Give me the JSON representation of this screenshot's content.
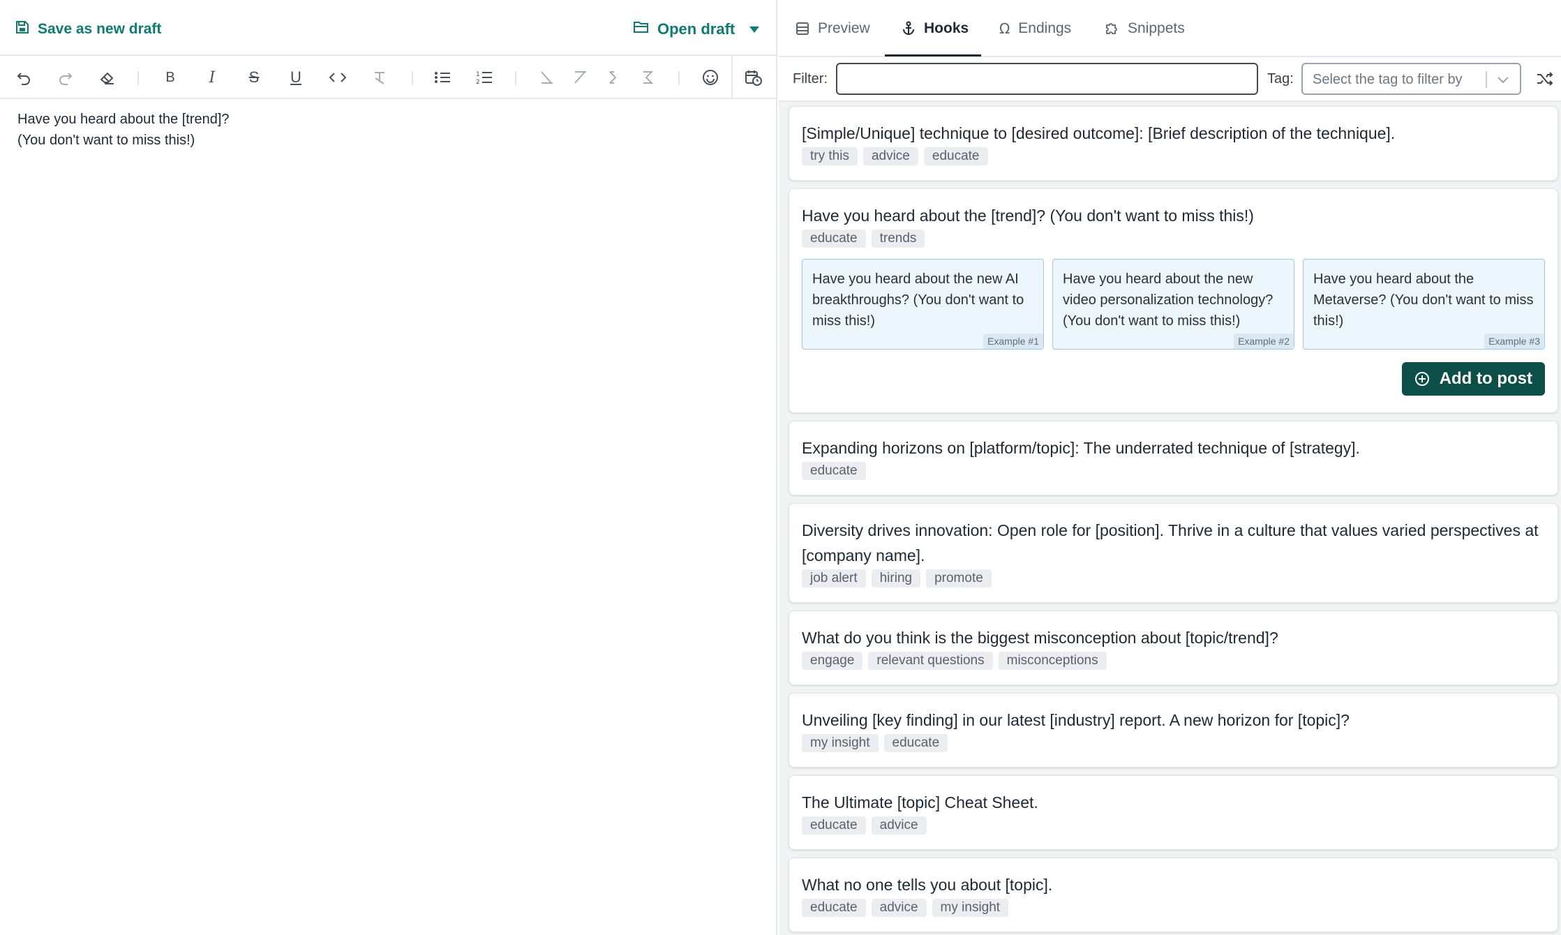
{
  "left_header": {
    "save_label": "Save as new draft",
    "open_label": "Open draft"
  },
  "toolbar": {
    "icons": [
      "undo-icon",
      "redo-icon",
      "eraser-icon",
      "bold-icon",
      "italic-icon",
      "strikethrough-icon",
      "underline-icon",
      "code-icon",
      "clear-format-icon",
      "bullet-list-icon",
      "numbered-list-icon",
      "format-1-icon",
      "format-2-icon",
      "format-3-icon",
      "format-4-icon",
      "emoji-icon",
      "schedule-icon"
    ],
    "bold": "B",
    "italic": "I",
    "strike": "S",
    "underline": "U"
  },
  "editor": {
    "lines": [
      "Have you heard about the [trend]?",
      "(You don't want to miss this!)"
    ]
  },
  "tabs": [
    {
      "label": "Preview",
      "icon": "preview-icon"
    },
    {
      "label": "Hooks",
      "icon": "anchor-icon",
      "active": true
    },
    {
      "label": "Endings",
      "icon": "omega-icon"
    },
    {
      "label": "Snippets",
      "icon": "puzzle-icon"
    }
  ],
  "filter": {
    "label": "Filter:",
    "value": "",
    "tag_label": "Tag:",
    "tag_placeholder": "Select the tag to filter by"
  },
  "hooks": [
    {
      "title": "[Simple/Unique] technique to [desired outcome]: [Brief description of the technique].",
      "tags": [
        "try this",
        "advice",
        "educate"
      ]
    },
    {
      "title": "Have you heard about the [trend]? (You don't want to miss this!)",
      "tags": [
        "educate",
        "trends"
      ],
      "examples": [
        {
          "text": "Have you heard about the new AI breakthroughs? (You don't want to miss this!)",
          "badge": "Example #1"
        },
        {
          "text": "Have you heard about the new video personalization technology? (You don't want to miss this!)",
          "badge": "Example #2"
        },
        {
          "text": "Have you heard about the Metaverse? (You don't want to miss this!)",
          "badge": "Example #3"
        }
      ],
      "action_label": "Add to post"
    },
    {
      "title": "Expanding horizons on [platform/topic]: The underrated technique of [strategy].",
      "tags": [
        "educate"
      ]
    },
    {
      "title": "Diversity drives innovation: Open role for [position]. Thrive in a culture that values varied perspectives at [company name].",
      "tags": [
        "job alert",
        "hiring",
        "promote"
      ]
    },
    {
      "title": "What do you think is the biggest misconception about [topic/trend]?",
      "tags": [
        "engage",
        "relevant questions",
        "misconceptions"
      ]
    },
    {
      "title": "Unveiling [key finding] in our latest [industry] report. A new horizon for [topic]?",
      "tags": [
        "my insight",
        "educate"
      ]
    },
    {
      "title": "The Ultimate [topic] Cheat Sheet.",
      "tags": [
        "educate",
        "advice"
      ]
    },
    {
      "title": "What no one tells you about [topic].",
      "tags": [
        "educate",
        "advice",
        "my insight"
      ]
    }
  ],
  "colors": {
    "accent": "#0f7a72",
    "button_dark": "#0b4f48",
    "example_bg": "#eef6fd"
  }
}
